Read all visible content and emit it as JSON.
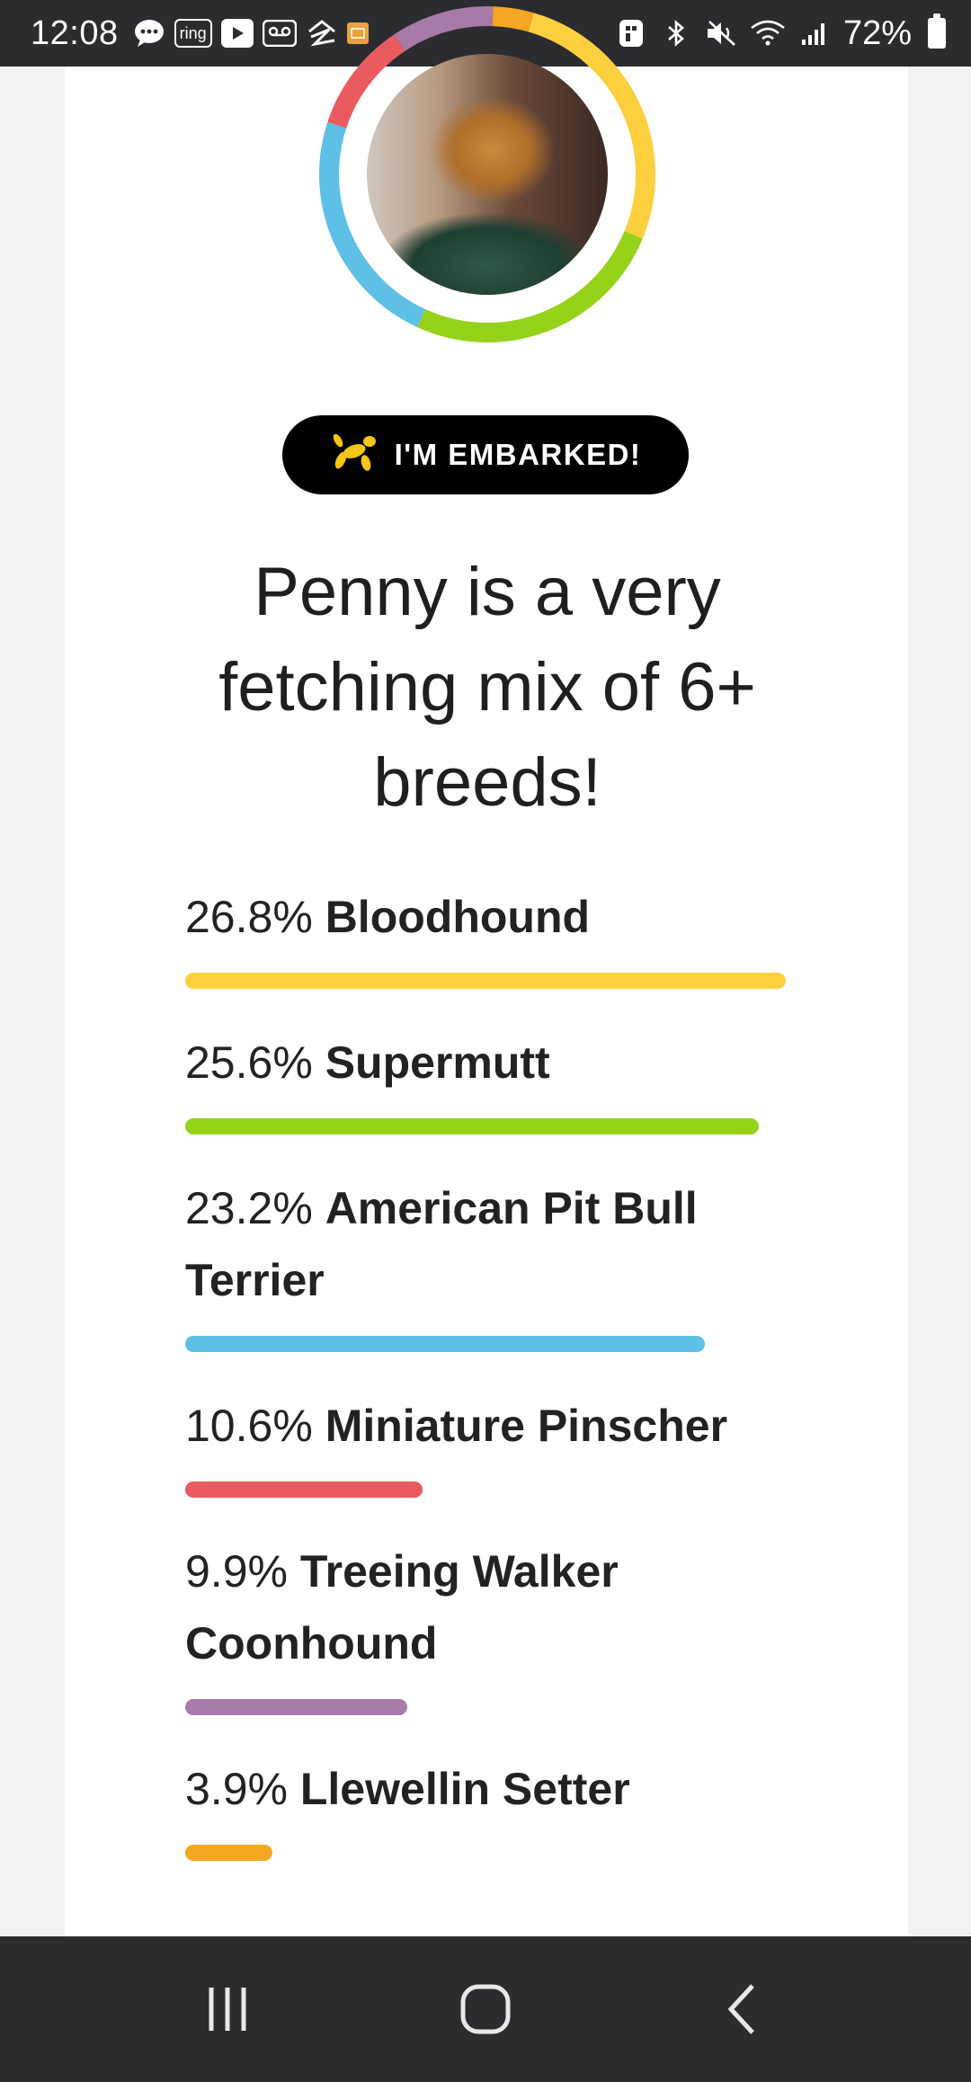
{
  "status_bar": {
    "time": "12:08",
    "ring_label": "ring",
    "battery": "72%"
  },
  "badge": {
    "label": "I'M EMBARKED!"
  },
  "headline": "Penny is a very fetching mix of 6+ breeds!",
  "breeds": [
    {
      "percent": "26.8%",
      "name": "Bloodhound",
      "fraction": 0.268,
      "color": "#fccf3e"
    },
    {
      "percent": "25.6%",
      "name": "Supermutt",
      "fraction": 0.256,
      "color": "#96d21a"
    },
    {
      "percent": "23.2%",
      "name": "American Pit Bull Terrier",
      "fraction": 0.232,
      "color": "#5ec0e6"
    },
    {
      "percent": "10.6%",
      "name": "Miniature Pinscher",
      "fraction": 0.106,
      "color": "#ea5b5f"
    },
    {
      "percent": "9.9%",
      "name": "Treeing Walker Coonhound",
      "fraction": 0.099,
      "color": "#a77aa8"
    },
    {
      "percent": "3.9%",
      "name": "Llewellin Setter",
      "fraction": 0.039,
      "color": "#f5a623"
    }
  ],
  "icons": {
    "badge": "dog-balloon-icon",
    "nav_recents": "recents-icon",
    "nav_home": "home-icon",
    "nav_back": "back-icon"
  }
}
